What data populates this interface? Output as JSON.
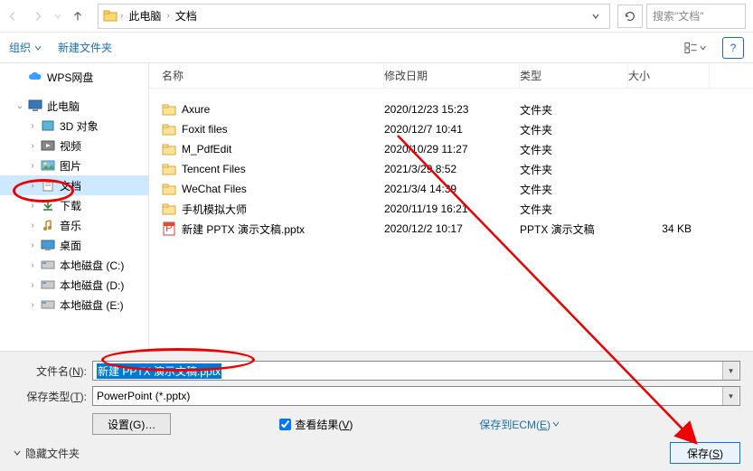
{
  "nav": {
    "crumbs": [
      "此电脑",
      "文档"
    ],
    "search_placeholder": "搜索\"文档\""
  },
  "toolbar": {
    "organize": "组织",
    "new_folder": "新建文件夹"
  },
  "sidebar": {
    "wps": "WPS网盘",
    "this_pc": "此电脑",
    "items": [
      "3D 对象",
      "视频",
      "图片",
      "文档",
      "下载",
      "音乐",
      "桌面",
      "本地磁盘 (C:)",
      "本地磁盘 (D:)",
      "本地磁盘 (E:)"
    ],
    "selected_index": 3
  },
  "columns": {
    "name": "名称",
    "date": "修改日期",
    "type": "类型",
    "size": "大小"
  },
  "files": [
    {
      "name": "Axure",
      "date": "2020/12/23 15:23",
      "type": "文件夹",
      "size": "",
      "kind": "folder"
    },
    {
      "name": "Foxit files",
      "date": "2020/12/7 10:41",
      "type": "文件夹",
      "size": "",
      "kind": "folder"
    },
    {
      "name": "M_PdfEdit",
      "date": "2020/10/29 11:27",
      "type": "文件夹",
      "size": "",
      "kind": "folder"
    },
    {
      "name": "Tencent Files",
      "date": "2021/3/29 8:52",
      "type": "文件夹",
      "size": "",
      "kind": "folder"
    },
    {
      "name": "WeChat Files",
      "date": "2021/3/4 14:39",
      "type": "文件夹",
      "size": "",
      "kind": "folder"
    },
    {
      "name": "手机模拟大师",
      "date": "2020/11/19 16:21",
      "type": "文件夹",
      "size": "",
      "kind": "folder"
    },
    {
      "name": "新建 PPTX 演示文稿.pptx",
      "date": "2020/12/2 10:17",
      "type": "PPTX 演示文稿",
      "size": "34 KB",
      "kind": "pptx"
    }
  ],
  "form": {
    "filename_label_pre": "文件名(",
    "filename_label_u": "N",
    "filename_label_post": "):",
    "filename_value": "新建 PPTX 演示文稿.pptx",
    "filetype_label_pre": "保存类型(",
    "filetype_label_u": "T",
    "filetype_label_post": "):",
    "filetype_value": "PowerPoint (*.pptx)",
    "settings_btn": "设置(G)…",
    "view_result_pre": "查看结果(",
    "view_result_u": "V",
    "view_result_post": ")",
    "save_ecm_pre": "保存到ECM(",
    "save_ecm_u": "E",
    "save_ecm_post": ")",
    "hide_folders": "隐藏文件夹",
    "save_btn_pre": "保存(",
    "save_btn_u": "S",
    "save_btn_post": ")"
  }
}
